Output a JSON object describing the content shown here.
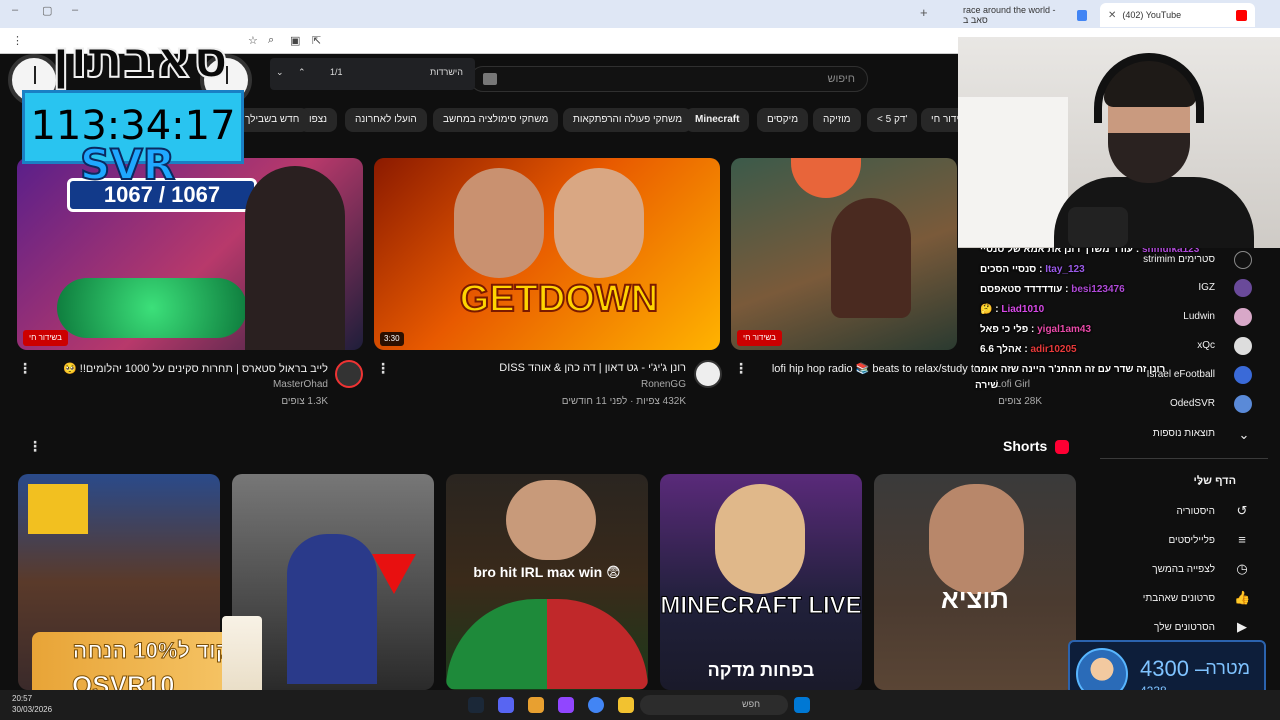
{
  "browser": {
    "tabs": [
      {
        "label": "(402) YouTube"
      },
      {
        "label": "race around the world - סאב ב"
      }
    ]
  },
  "find_bar": {
    "query": "הישרדות",
    "count": "1/1"
  },
  "header": {
    "search_placeholder": "חיפוש"
  },
  "chips": [
    "משחקי סימולציה במחשב",
    "משחקי פעולה והרפתקאות",
    "Minecraft",
    "מיקסים",
    "מוזיקה",
    "< 5 דק'",
    "בשידור חי",
    "הועלו לאחרונה",
    "נצפו",
    "חדש בשבילך"
  ],
  "videos": [
    {
      "title": "לייב בראול סטארס | תחרות סקינים על 1000 יהלומים!! 🥺",
      "channel": "MasterOhad",
      "meta": "1.3K צופים",
      "badge": "בשידור חי",
      "thumb_text": "1067 / 1067"
    },
    {
      "title": "רונן ג'יג'י - גט דאון | דה כהן & אוהד DISS",
      "channel": "RonenGG",
      "meta": "432K צפיות · לפני 11 חודשים",
      "duration": "3:30",
      "thumb_text": "GETDOWN"
    },
    {
      "title": "lofi hip hop radio 📚 beats to relax/study to",
      "channel": "Lofi Girl",
      "meta": "28K צופים",
      "badge": "בשידור חי"
    }
  ],
  "shorts": {
    "title": "Shorts",
    "items": [
      {
        "text": "תוציא"
      },
      {
        "text": "MINECRAFT LIVE",
        "sub": "בפחות מדקה"
      },
      {
        "text": "bro hit IRL max win 😨"
      },
      {
        "text": ""
      },
      {
        "text": ""
      }
    ]
  },
  "sidebar": {
    "subscriptions": [
      {
        "label": "strimim סטרימים"
      },
      {
        "label": "IGZ"
      },
      {
        "label": "Ludwin"
      },
      {
        "label": "xQc"
      },
      {
        "label": "Israel eFootball"
      },
      {
        "label": "OdedSVR"
      }
    ],
    "more": "תוצאות נוספות",
    "you_title": "הדף שלי",
    "you_items": [
      {
        "label": "היסטוריה",
        "icon": "history-icon"
      },
      {
        "label": "פלייליסטים",
        "icon": "playlist-icon"
      },
      {
        "label": "לצפייה בהמשך",
        "icon": "clock-icon"
      },
      {
        "label": "סרטונים שאהבתי",
        "icon": "thumbs-up-icon"
      },
      {
        "label": "הסרטונים שלך",
        "icon": "video-icon"
      }
    ]
  },
  "chat": [
    {
      "user": "shmulka123",
      "msg": "עודד משדך רונן את אמא של סנסיי"
    },
    {
      "user": "Itay_123",
      "msg": "סנסיי הסכים"
    },
    {
      "user": "besi123476",
      "msg": "עודדדדד סטאפסם"
    },
    {
      "user": "Liad1010",
      "msg": "🤔"
    },
    {
      "user": "yigal1am43",
      "msg": "פלי כי פאל"
    },
    {
      "user": "adir10205",
      "msg": "אהלך 6.6"
    },
    {
      "user": "",
      "msg": "רונן זה שדר עם זה תהתנ'ר היינה שזה אומר"
    },
    {
      "user": "",
      "msg": "שירה"
    }
  ],
  "overlay": {
    "logo": "סאבתון",
    "timer": "113:34:17",
    "brand": "SVR",
    "promo_line1": "קוד ל10% הנחה",
    "promo_line2": "OSVR10",
    "goal_label": "מטרה",
    "goal_value": "4300 –",
    "goal_current": "4238"
  },
  "taskbar": {
    "time": "20:57",
    "date": "30/03/2026",
    "search": "חפש"
  },
  "colors": {
    "accent": "#ff0000",
    "bg": "#0f0f0f",
    "chip": "#272727",
    "timer_bg": "#29c4f0"
  }
}
